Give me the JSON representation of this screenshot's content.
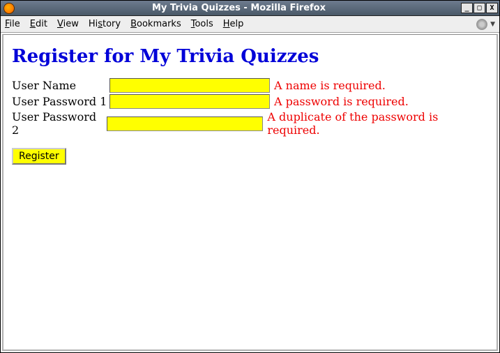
{
  "window": {
    "title": "My Trivia Quizzes - Mozilla Firefox"
  },
  "menubar": {
    "file": "File",
    "edit": "Edit",
    "view": "View",
    "history": "History",
    "bookmarks": "Bookmarks",
    "tools": "Tools",
    "help": "Help"
  },
  "page": {
    "heading": "Register for My Trivia Quizzes"
  },
  "form": {
    "rows": [
      {
        "label": "User Name",
        "value": "",
        "error": "A name is required."
      },
      {
        "label": "User Password 1",
        "value": "",
        "error": "A password is required."
      },
      {
        "label": "User Password 2",
        "value": "",
        "error": "A duplicate of the password is required."
      }
    ],
    "submit_label": "Register"
  },
  "titlebar_buttons": {
    "minimize": "_",
    "maximize": "□",
    "close": "X"
  }
}
